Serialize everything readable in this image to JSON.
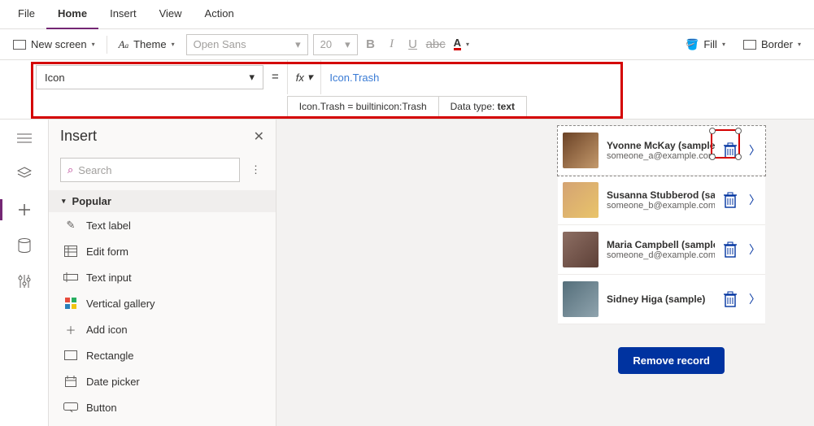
{
  "menubar": [
    "File",
    "Home",
    "Insert",
    "View",
    "Action"
  ],
  "menubar_active": 1,
  "toolbar": {
    "newscreen": "New screen",
    "theme": "Theme",
    "font": "Open Sans",
    "size": "20",
    "fill": "Fill",
    "border": "Border"
  },
  "formula": {
    "property": "Icon",
    "value": "Icon.Trash",
    "hint_left": "Icon.Trash  =  builtinicon:Trash",
    "hint_right_label": "Data type: ",
    "hint_right_value": "text"
  },
  "panel": {
    "title": "Insert",
    "search_placeholder": "Search",
    "group": "Popular",
    "items": [
      "Text label",
      "Edit form",
      "Text input",
      "Vertical gallery",
      "Add icon",
      "Rectangle",
      "Date picker",
      "Button"
    ]
  },
  "gallery": [
    {
      "name": "Yvonne McKay (sample)",
      "email": "someone_a@example.com"
    },
    {
      "name": "Susanna Stubberod (sample)",
      "email": "someone_b@example.com"
    },
    {
      "name": "Maria Campbell (sample)",
      "email": "someone_d@example.com"
    },
    {
      "name": "Sidney Higa (sample)",
      "email": ""
    }
  ],
  "remove_label": "Remove record"
}
